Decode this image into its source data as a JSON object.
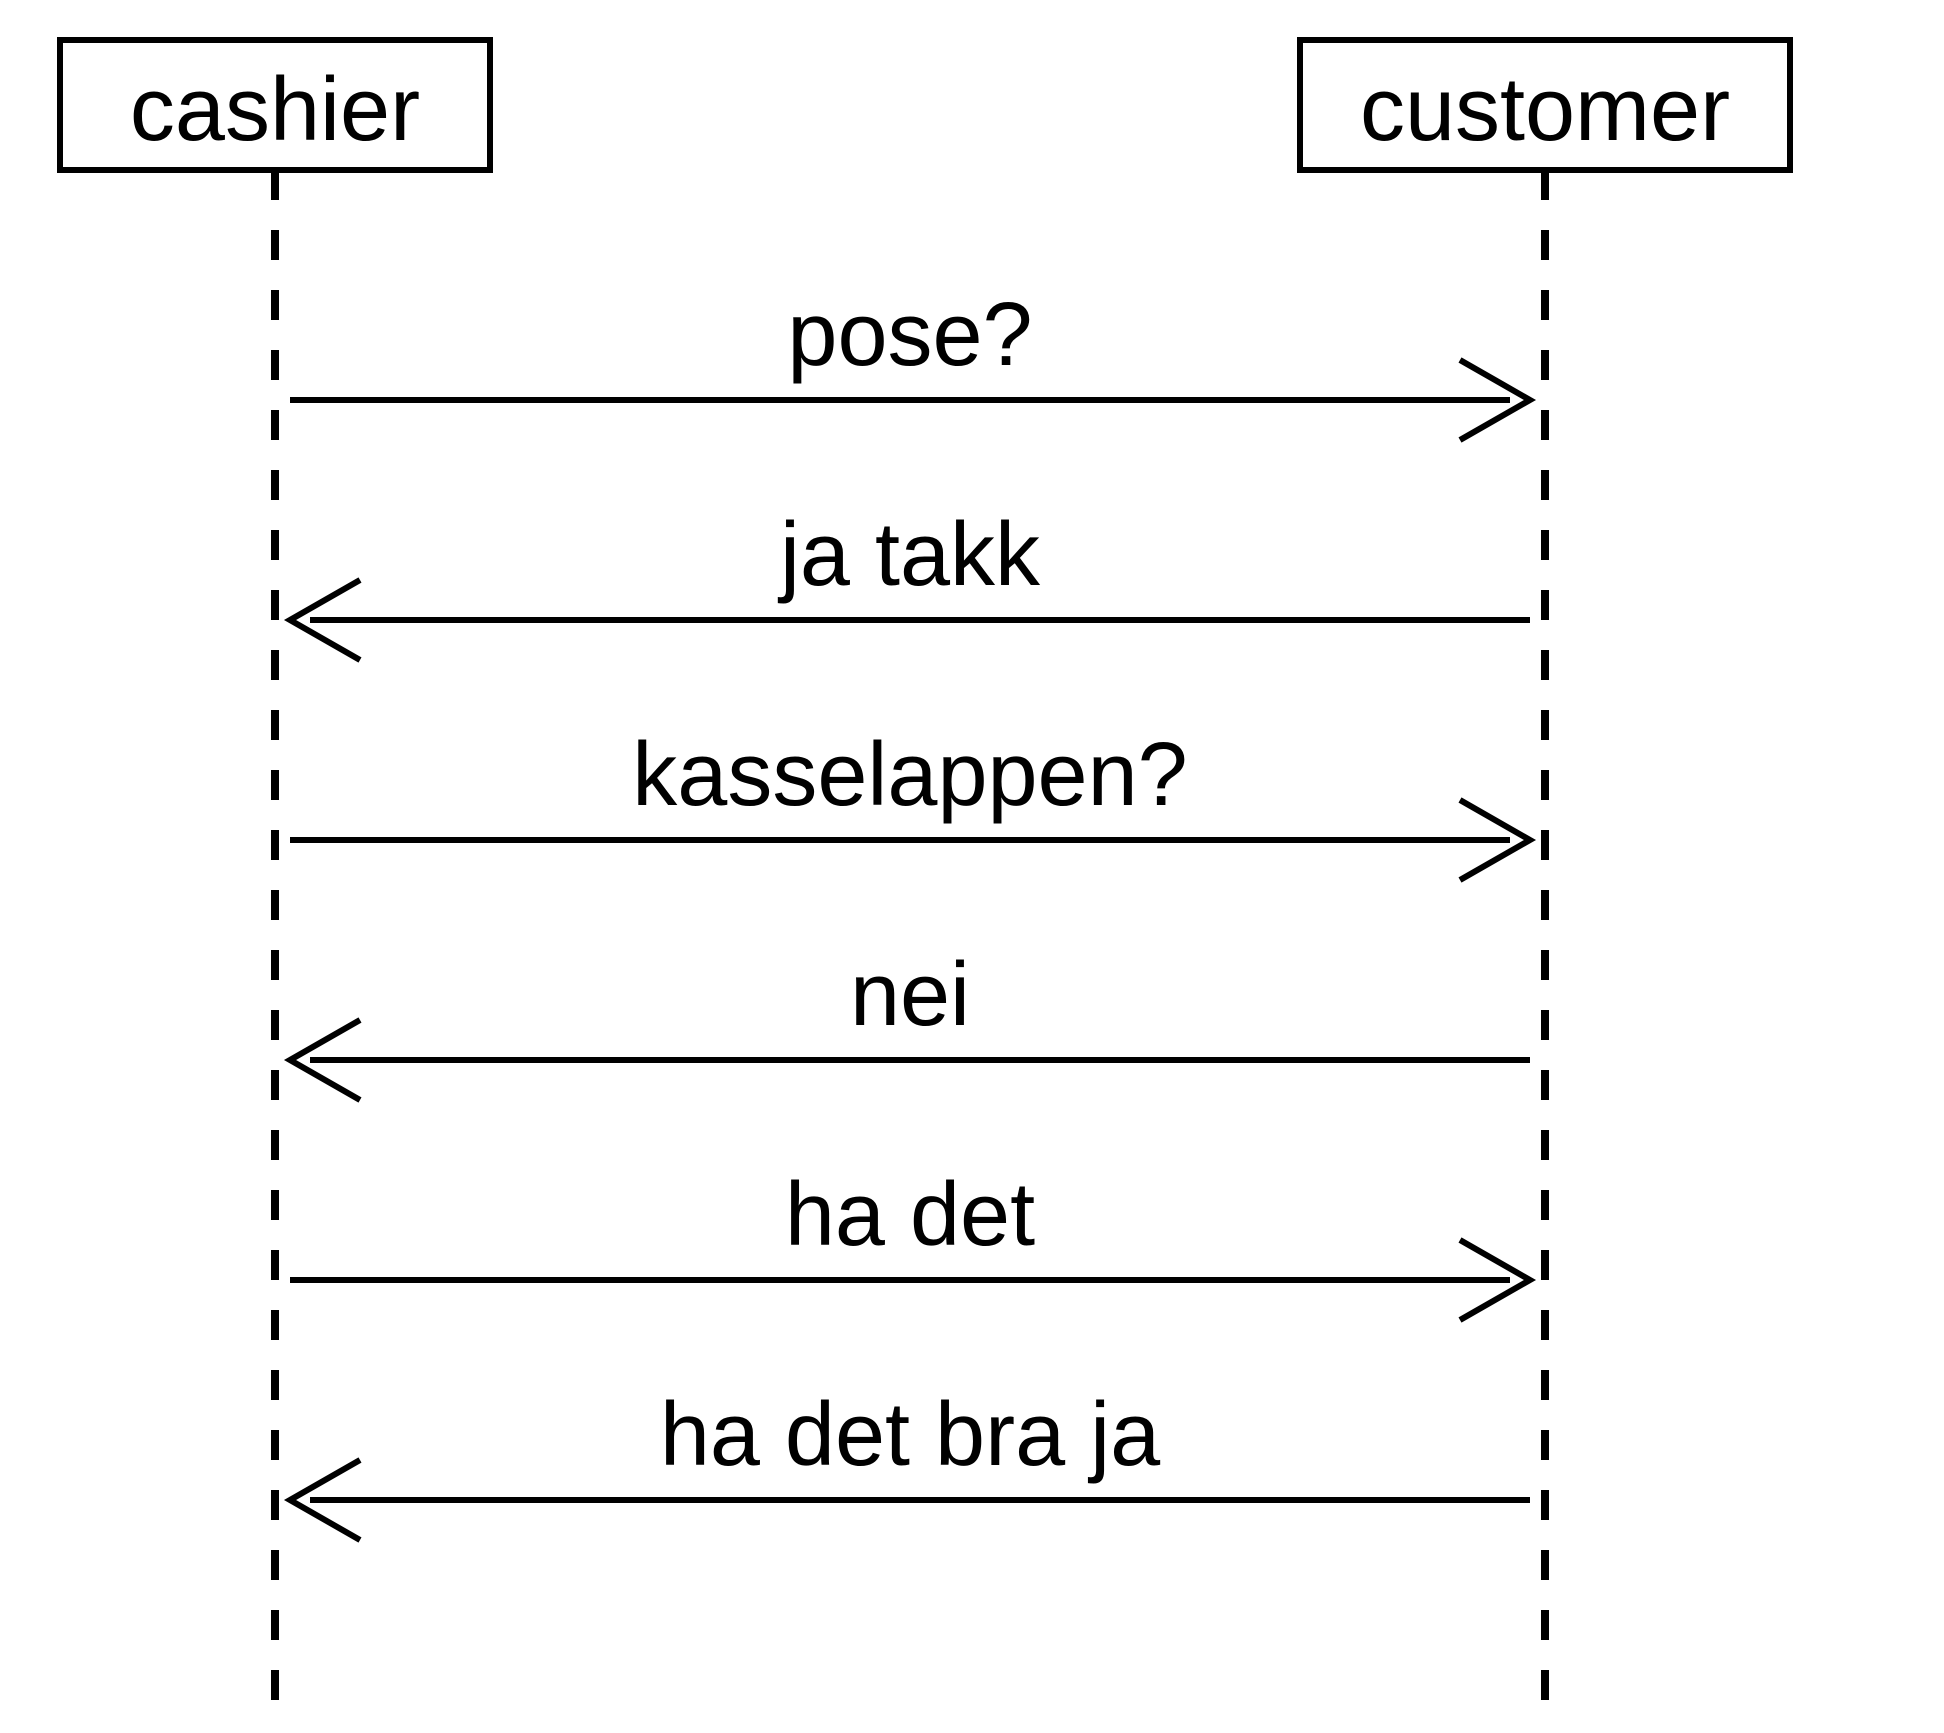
{
  "participants": {
    "left": {
      "label": "cashier"
    },
    "right": {
      "label": "customer"
    }
  },
  "messages": [
    {
      "label": "pose?",
      "direction": "right"
    },
    {
      "label": "ja takk",
      "direction": "left"
    },
    {
      "label": "kasselappen?",
      "direction": "right"
    },
    {
      "label": "nei",
      "direction": "left"
    },
    {
      "label": "ha det",
      "direction": "right"
    },
    {
      "label": "ha det bra ja",
      "direction": "left"
    }
  ]
}
